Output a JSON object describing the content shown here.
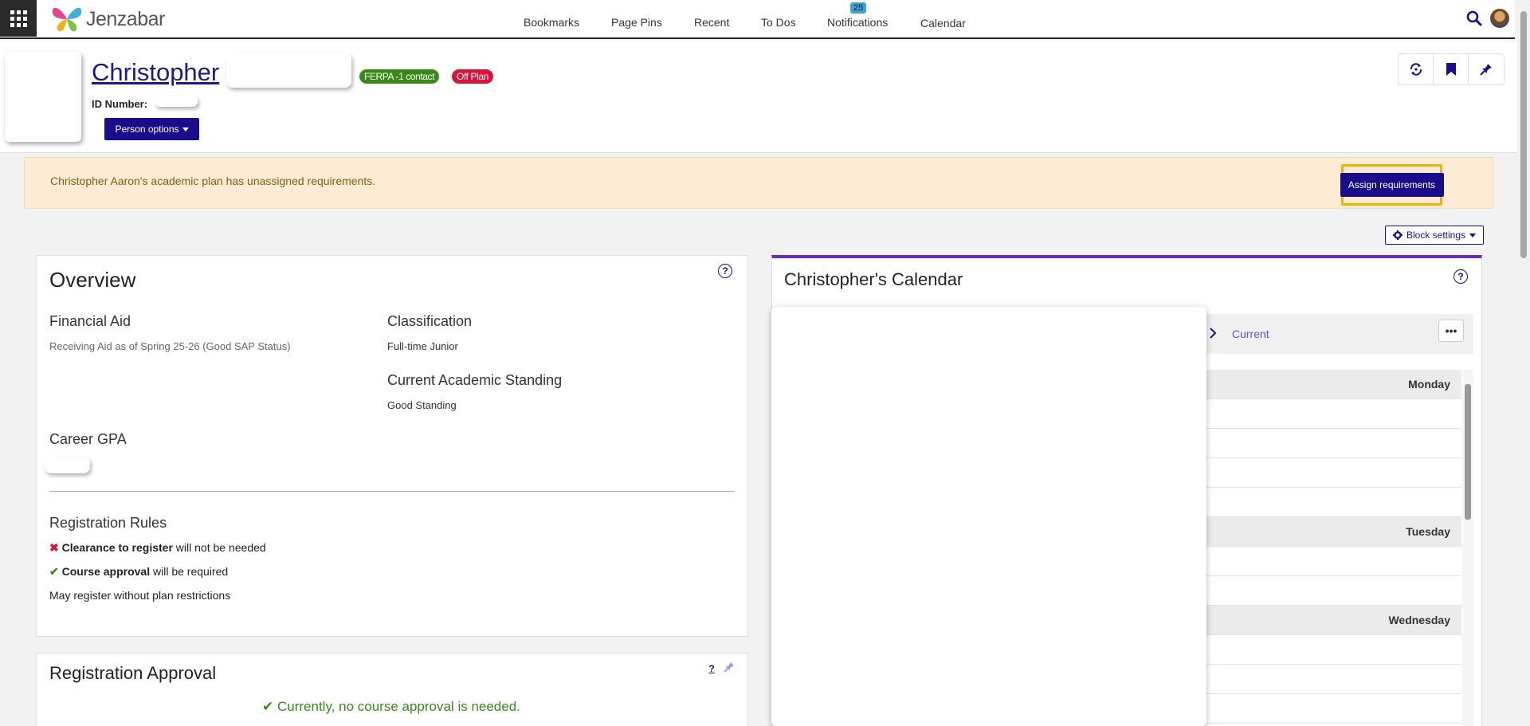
{
  "topbar": {
    "brand": "Jenzabar",
    "nav": [
      "Bookmarks",
      "Page Pins",
      "Recent",
      "To Dos",
      "Notifications",
      "Calendar"
    ],
    "notifications_count": "25"
  },
  "person": {
    "first_name": "Christopher",
    "badges": {
      "ferpa": "FERPA -1 contact",
      "off_plan": "Off Plan"
    },
    "id_label": "ID Number:",
    "options_label": "Person options"
  },
  "alert": {
    "text": "Christopher Aaron's academic plan has unassigned requirements.",
    "button": "Assign requirements"
  },
  "block_settings": "Block settings",
  "overview": {
    "title": "Overview",
    "financial_aid_label": "Financial Aid",
    "financial_aid_value": "Receiving Aid as of Spring 25-26 (Good SAP Status)",
    "classification_label": "Classification",
    "classification_value": "Full-time Junior",
    "standing_label": "Current Academic Standing",
    "standing_value": "Good Standing",
    "gpa_label": "Career GPA",
    "rules_title": "Registration Rules",
    "rule1_bold": "Clearance to register",
    "rule1_rest": " will not be needed",
    "rule2_bold": "Course approval",
    "rule2_rest": " will be required",
    "rule3": "May register without plan restrictions"
  },
  "approval": {
    "title": "Registration Approval",
    "status": "Currently, no course approval is needed."
  },
  "calendar": {
    "title": "Christopher's Calendar",
    "current_label": "Current",
    "days": [
      "Monday",
      "Tuesday",
      "Wednesday"
    ]
  },
  "colors": {
    "brand": "#1a0d8c",
    "ferpa": "#3a8a1a",
    "off_plan": "#d9143a",
    "alert_bg": "#fdebd3",
    "highlight": "#e8b20f",
    "calendar_accent": "#6a2bb0"
  }
}
